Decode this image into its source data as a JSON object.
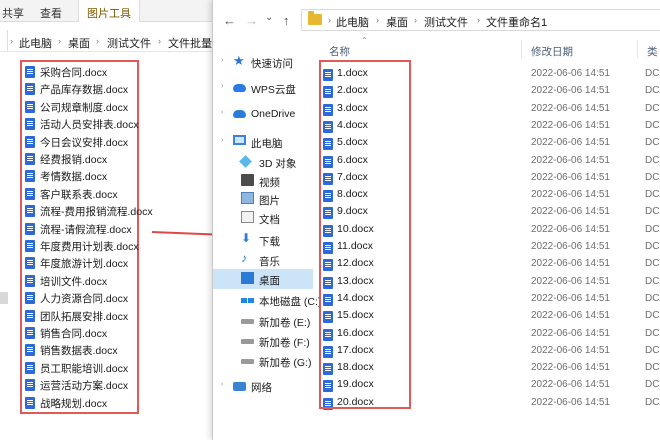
{
  "left_window": {
    "ribbon_tabs": [
      "共享",
      "查看",
      "图片工具"
    ],
    "breadcrumb": [
      "此电脑",
      "桌面",
      "测试文件",
      "文件批量重"
    ],
    "files": [
      "采购合同.docx",
      "产品库存数据.docx",
      "公司规章制度.docx",
      "活动人员安排表.docx",
      "今日会议安排.docx",
      "经费报销.docx",
      "考情数据.docx",
      "客户联系表.docx",
      "流程-费用报销流程.docx",
      "流程-请假流程.docx",
      "年度费用计划表.docx",
      "年度旅游计划.docx",
      "培训文件.docx",
      "人力资源合同.docx",
      "团队拓展安排.docx",
      "销售合同.docx",
      "销售数据表.docx",
      "员工职能培训.docx",
      "运营活动方案.docx",
      "战略规划.docx"
    ]
  },
  "right_window": {
    "nav": {
      "back": "←",
      "forward": "→",
      "dropdown": "⌄",
      "up": "↑"
    },
    "breadcrumb": [
      "此电脑",
      "桌面",
      "测试文件",
      "文件重命名1"
    ],
    "sidebar": [
      {
        "label": "快速访问",
        "icon": "star-icon"
      },
      {
        "label": "WPS云盘",
        "icon": "cloud-icon"
      },
      {
        "label": "OneDrive",
        "icon": "onedrive-icon"
      },
      {
        "label": "此电脑",
        "icon": "computer-icon"
      },
      {
        "label": "3D 对象",
        "icon": "3d-objects-icon"
      },
      {
        "label": "视频",
        "icon": "video-icon"
      },
      {
        "label": "图片",
        "icon": "pictures-icon"
      },
      {
        "label": "文档",
        "icon": "documents-icon"
      },
      {
        "label": "下载",
        "icon": "download-icon"
      },
      {
        "label": "音乐",
        "icon": "music-icon"
      },
      {
        "label": "桌面",
        "icon": "desktop-icon"
      },
      {
        "label": "本地磁盘 (C:)",
        "icon": "system-drive-icon"
      },
      {
        "label": "新加卷 (E:)",
        "icon": "drive-icon"
      },
      {
        "label": "新加卷 (F:)",
        "icon": "drive-icon"
      },
      {
        "label": "新加卷 (G:)",
        "icon": "drive-icon"
      },
      {
        "label": "网络",
        "icon": "network-icon"
      }
    ],
    "columns": {
      "name": "名称",
      "date": "修改日期",
      "type": "类"
    },
    "files": [
      {
        "name": "1.docx",
        "date": "2022-06-06 14:51",
        "type": "DC"
      },
      {
        "name": "2.docx",
        "date": "2022-06-06 14:51",
        "type": "DC"
      },
      {
        "name": "3.docx",
        "date": "2022-06-06 14:51",
        "type": "DC"
      },
      {
        "name": "4.docx",
        "date": "2022-06-06 14:51",
        "type": "DC"
      },
      {
        "name": "5.docx",
        "date": "2022-06-06 14:51",
        "type": "DC"
      },
      {
        "name": "6.docx",
        "date": "2022-06-06 14:51",
        "type": "DC"
      },
      {
        "name": "7.docx",
        "date": "2022-06-06 14:51",
        "type": "DC"
      },
      {
        "name": "8.docx",
        "date": "2022-06-06 14:51",
        "type": "DC"
      },
      {
        "name": "9.docx",
        "date": "2022-06-06 14:51",
        "type": "DC"
      },
      {
        "name": "10.docx",
        "date": "2022-06-06 14:51",
        "type": "DC"
      },
      {
        "name": "11.docx",
        "date": "2022-06-06 14:51",
        "type": "DC"
      },
      {
        "name": "12.docx",
        "date": "2022-06-06 14:51",
        "type": "DC"
      },
      {
        "name": "13.docx",
        "date": "2022-06-06 14:51",
        "type": "DC"
      },
      {
        "name": "14.docx",
        "date": "2022-06-06 14:51",
        "type": "DC"
      },
      {
        "name": "15.docx",
        "date": "2022-06-06 14:51",
        "type": "DC"
      },
      {
        "name": "16.docx",
        "date": "2022-06-06 14:51",
        "type": "DC"
      },
      {
        "name": "17.docx",
        "date": "2022-06-06 14:51",
        "type": "DC"
      },
      {
        "name": "18.docx",
        "date": "2022-06-06 14:51",
        "type": "DC"
      },
      {
        "name": "19.docx",
        "date": "2022-06-06 14:51",
        "type": "DC"
      },
      {
        "name": "20.docx",
        "date": "2022-06-06 14:51",
        "type": "DC"
      }
    ]
  },
  "colors": {
    "highlight_box": "#e05a5a",
    "arrow": "#e04848",
    "selected": "#cce4f7",
    "accent": "#2b6ad8"
  }
}
